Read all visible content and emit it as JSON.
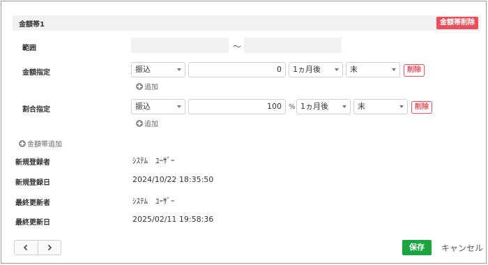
{
  "band": {
    "title": "金額帯1",
    "delete_label": "金額帯削除"
  },
  "range": {
    "label": "範囲",
    "separator": "～"
  },
  "amount": {
    "label": "金額指定",
    "method": "振込",
    "value": "0",
    "timing": "1ヵ月後",
    "day": "末",
    "delete_label": "削除",
    "add_label": "追加"
  },
  "ratio": {
    "label": "割合指定",
    "method": "振込",
    "value": "100",
    "unit": "%",
    "timing": "1ヵ月後",
    "day": "末",
    "delete_label": "削除",
    "add_label": "追加"
  },
  "add_band_label": "金額帯追加",
  "info": {
    "created_by_label": "新規登録者",
    "created_by": "ｼｽﾃﾑ　ﾕｰｻﾞｰ",
    "created_at_label": "新規登録日",
    "created_at": "2024/10/22 18:35:50",
    "updated_by_label": "最終更新者",
    "updated_by": "ｼｽﾃﾑ　ﾕｰｻﾞｰ",
    "updated_at_label": "最終更新日",
    "updated_at": "2025/02/11 19:58:36"
  },
  "footer": {
    "prev_icon": "chevron-left-icon",
    "next_icon": "chevron-right-icon",
    "save_label": "保存",
    "cancel_label": "キャンセル"
  },
  "colors": {
    "danger": "#e8505b",
    "success": "#1aa53e"
  }
}
